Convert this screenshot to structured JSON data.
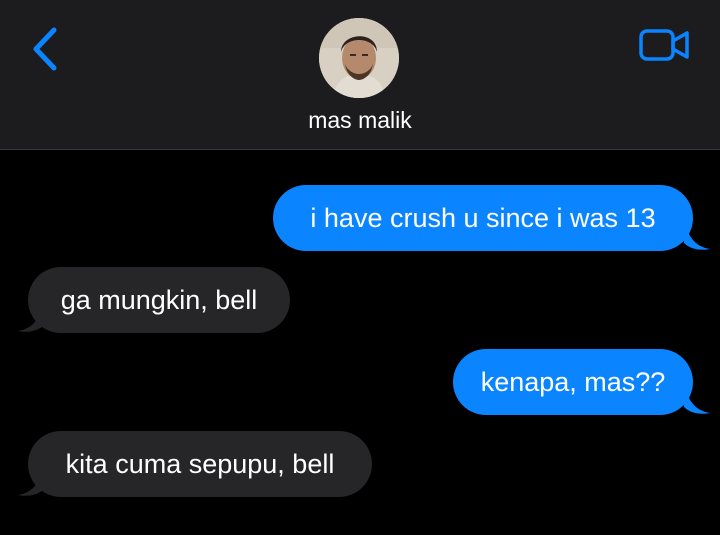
{
  "header": {
    "contact_name": "mas malik",
    "back_icon": "chevron-left-icon",
    "video_icon": "video-camera-icon",
    "accent_color": "#0a84ff"
  },
  "messages": [
    {
      "direction": "sent",
      "text": "i have crush u since i was 13"
    },
    {
      "direction": "received",
      "text": "ga mungkin, bell"
    },
    {
      "direction": "sent",
      "text": "kenapa, mas??"
    },
    {
      "direction": "received",
      "text": "kita cuma sepupu, bell"
    }
  ],
  "colors": {
    "sent_bubble": "#0a84ff",
    "received_bubble": "#262628",
    "background": "#000000",
    "header": "#1c1c1e"
  }
}
